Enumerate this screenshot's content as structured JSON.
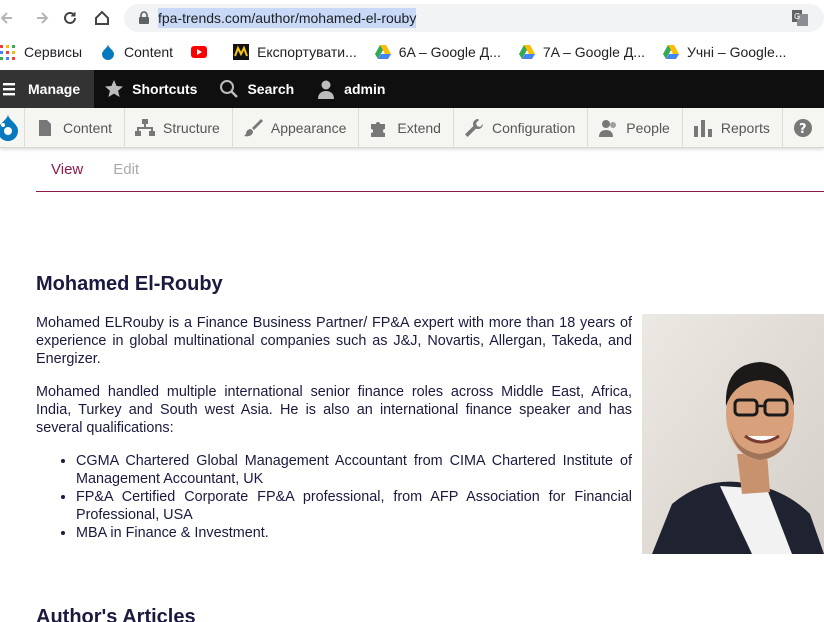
{
  "browser": {
    "url": "fpa-trends.com/author/mohamed-el-rouby",
    "bookmarks": [
      {
        "label": "Сервисы",
        "icon": "apps-grid-icon"
      },
      {
        "label": "Content",
        "icon": "drupal-icon"
      },
      {
        "label": "",
        "icon": "youtube-icon"
      },
      {
        "label": "Експортувати...",
        "icon": "site-favicon-icon"
      },
      {
        "label": "6A – Google Д...",
        "icon": "google-drive-icon"
      },
      {
        "label": "7A – Google Д...",
        "icon": "google-drive-icon"
      },
      {
        "label": "Учні – Google...",
        "icon": "google-drive-icon"
      }
    ]
  },
  "toolbar": {
    "manage": "Manage",
    "shortcuts": "Shortcuts",
    "search": "Search",
    "user": "admin"
  },
  "tray": {
    "content": "Content",
    "structure": "Structure",
    "appearance": "Appearance",
    "extend": "Extend",
    "configuration": "Configuration",
    "people": "People",
    "reports": "Reports"
  },
  "tabs": {
    "view": "View",
    "edit": "Edit"
  },
  "author": {
    "name": "Mohamed El-Rouby",
    "bio_p1": "Mohamed ELRouby is a Finance Business Partner/ FP&A expert with more than 18 years of experience in global multinational companies such as J&J, Novartis, Allergan, Takeda, and Energizer.",
    "bio_p2": "Mohamed handled multiple international senior finance roles across Middle East, Africa, India, Turkey and South west Asia. He is also an international finance speaker and has several qualifications:",
    "qualifications": [
      "CGMA Chartered Global Management Accountant from CIMA Chartered Institute of Management Accountant, UK",
      "FP&A Certified Corporate FP&A professional, from AFP Association for Financial Professional, USA",
      "MBA in Finance & Investment."
    ]
  },
  "articles_heading": "Author's Articles",
  "colors": {
    "accent": "#8c1a4a",
    "heading": "#1a1a40",
    "toolbar": "#0f0f0f"
  }
}
